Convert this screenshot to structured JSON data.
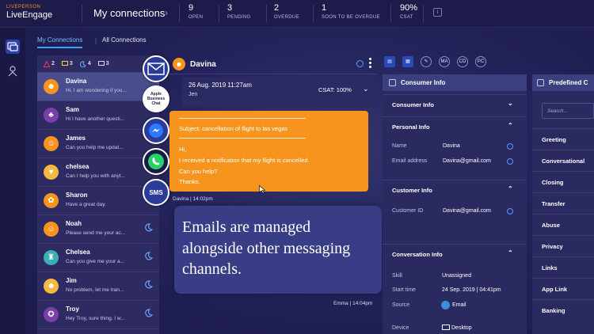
{
  "brand": {
    "small": "LIVEPERSON",
    "name": "LiveEngage"
  },
  "header": {
    "title": "My connections",
    "kpis": [
      {
        "value": "9",
        "label": "OPEN"
      },
      {
        "value": "3",
        "label": "PENDING"
      },
      {
        "value": "2",
        "label": "OVERDUE"
      },
      {
        "value": "1",
        "label": "SOON TO BE OVERDUE"
      },
      {
        "value": "90%",
        "label": "CSAT"
      }
    ]
  },
  "tabs": {
    "my": "My Connections",
    "all": "All Connections"
  },
  "counts": [
    {
      "icon": "alert-icon",
      "value": "2"
    },
    {
      "icon": "message-icon",
      "value": "3"
    },
    {
      "icon": "moon-icon",
      "value": "4"
    },
    {
      "icon": "chat-icon",
      "value": "3"
    }
  ],
  "conversations": [
    {
      "name": "Davina",
      "preview": "Hi, I am wondering if you...",
      "color": "#f7941d",
      "glyph": "☻",
      "moon": false
    },
    {
      "name": "Sam",
      "preview": "Hi I have another questi...",
      "color": "#7b3fa8",
      "glyph": "♣",
      "moon": false
    },
    {
      "name": "James",
      "preview": "Can you help me updat...",
      "color": "#f7941d",
      "glyph": "☺",
      "moon": false
    },
    {
      "name": "chelsea",
      "preview": "Can I help you with anyt...",
      "color": "#f4b942",
      "glyph": "♥",
      "moon": false
    },
    {
      "name": "Sharon",
      "preview": "Have a great day.",
      "color": "#f7941d",
      "glyph": "✿",
      "moon": false
    },
    {
      "name": "Noah",
      "preview": "Please send me your ac...",
      "color": "#f7941d",
      "glyph": "☺",
      "moon": true
    },
    {
      "name": "Chelsea",
      "preview": "Can you give me your a...",
      "color": "#3ab0b5",
      "glyph": "♜",
      "moon": true
    },
    {
      "name": "Jim",
      "preview": "No problem, let me tran...",
      "color": "#f4b942",
      "glyph": "☻",
      "moon": true
    },
    {
      "name": "Troy",
      "preview": "Hey Troy, sure thing. I w...",
      "color": "#7b3fa8",
      "glyph": "✪",
      "moon": true
    }
  ],
  "channels": [
    {
      "name": "email-channel-icon",
      "label": ""
    },
    {
      "name": "apple-business-chat-icon",
      "label": "Apple Business Chat"
    },
    {
      "name": "messenger-icon",
      "label": ""
    },
    {
      "name": "whatsapp-icon",
      "label": ""
    },
    {
      "name": "sms-icon",
      "label": "SMS"
    }
  ],
  "chat": {
    "name": "Davina",
    "date": "26 Aug. 2019 11:27am",
    "agent": "Jen",
    "csat": "CSAT: 100%",
    "email": {
      "subject": "Subject: cancellation of flight to las vegas",
      "greeting": "Hi,",
      "line1": "I received a notification that my flight is cancelled.",
      "line2": "Can you help?",
      "line3": "Thanks."
    },
    "email_meta": "Davina | 14:02pm",
    "overlay_lines": [
      "Emails are managed",
      "alongside other messaging",
      "channels."
    ],
    "reply_meta": "Emma | 14:04pm"
  },
  "toolbar": [
    "MA",
    "CD",
    "PC"
  ],
  "consumer_info": {
    "title": "Consumer Info",
    "sections": {
      "consumer": "Consumer Info",
      "personal": "Personal Info",
      "customer": "Customer Info",
      "conversation": "Conversation Info"
    },
    "name_label": "Name",
    "name_value": "Davina",
    "email_label": "Email address",
    "email_value": "Davina@gmail.com",
    "cid_label": "Customer ID",
    "cid_value": "Davina@gmail.com",
    "skill_label": "Skill",
    "skill_value": "Unassigned",
    "start_label": "Start time",
    "start_value": "24 Sep. 2019 | 04:41pm",
    "source_label": "Source",
    "source_value": "Email",
    "device_label": "Device",
    "device_value": "Desktop"
  },
  "predefined": {
    "title": "Predefined C",
    "search_placeholder": "Search...",
    "items": [
      "Greeting",
      "Conversational",
      "Closing",
      "Transfer",
      "Abuse",
      "Privacy",
      "Links",
      "App Link",
      "Banking"
    ]
  }
}
